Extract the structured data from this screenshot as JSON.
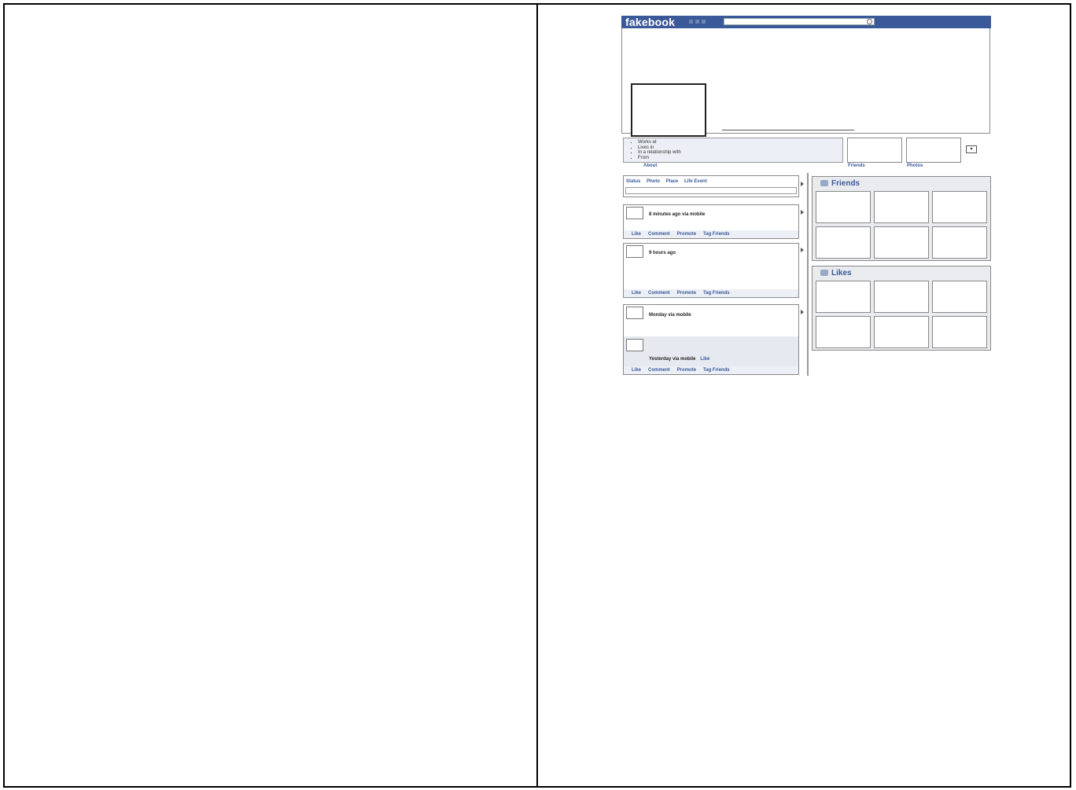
{
  "header": {
    "logo": "fakebook"
  },
  "about": {
    "items": [
      "Works at",
      "Lives in",
      "In a relationship with",
      "From"
    ],
    "label": "About"
  },
  "tabs": {
    "friends": "Friends",
    "photos": "Photos"
  },
  "composer": {
    "options": [
      "Status",
      "Photo",
      "Place",
      "Life Event"
    ]
  },
  "posts": [
    {
      "meta": "8 minutes ago via mobile",
      "actions": [
        "Like",
        "Comment",
        "Promote",
        "Tag Friends"
      ]
    },
    {
      "meta": "9 hours ago",
      "actions": [
        "Like",
        "Comment",
        "Promote",
        "Tag Friends"
      ]
    },
    {
      "meta": "Monday via mobile",
      "actions": [
        "Like",
        "Comment",
        "Promote",
        "Tag Friends"
      ],
      "comment": {
        "meta": "Yesterday via mobile",
        "link": "Like"
      }
    }
  ],
  "sidebar": {
    "friends_title": "Friends",
    "likes_title": "Likes"
  }
}
